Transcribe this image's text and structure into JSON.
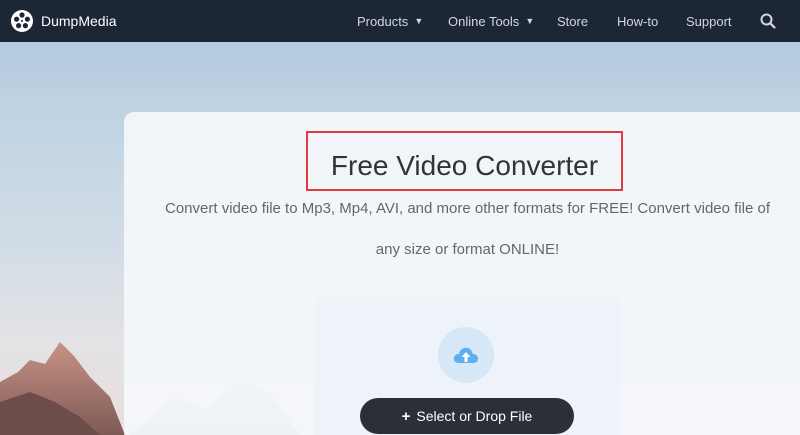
{
  "brand": {
    "name": "DumpMedia"
  },
  "nav": {
    "items": [
      {
        "label": "Products",
        "has_dropdown": true
      },
      {
        "label": "Online Tools",
        "has_dropdown": true
      },
      {
        "label": "Store",
        "has_dropdown": false
      },
      {
        "label": "How-to",
        "has_dropdown": false
      },
      {
        "label": "Support",
        "has_dropdown": false
      }
    ],
    "caret": "▼",
    "search_icon": "search-icon"
  },
  "hero": {
    "title": "Free Video Converter",
    "description_line1": "Convert video file to Mp3, Mp4, AVI, and more other formats for FREE! Convert video file of",
    "description_line2": "any size or format ONLINE!",
    "upload_icon": "cloud-upload-icon",
    "button_plus": "+",
    "button_label": "Select or Drop File"
  },
  "colors": {
    "nav_bg": "#1c2634",
    "highlight_border": "#e0393e",
    "button_bg": "#2c2f35",
    "accent": "#4aa3e8"
  }
}
